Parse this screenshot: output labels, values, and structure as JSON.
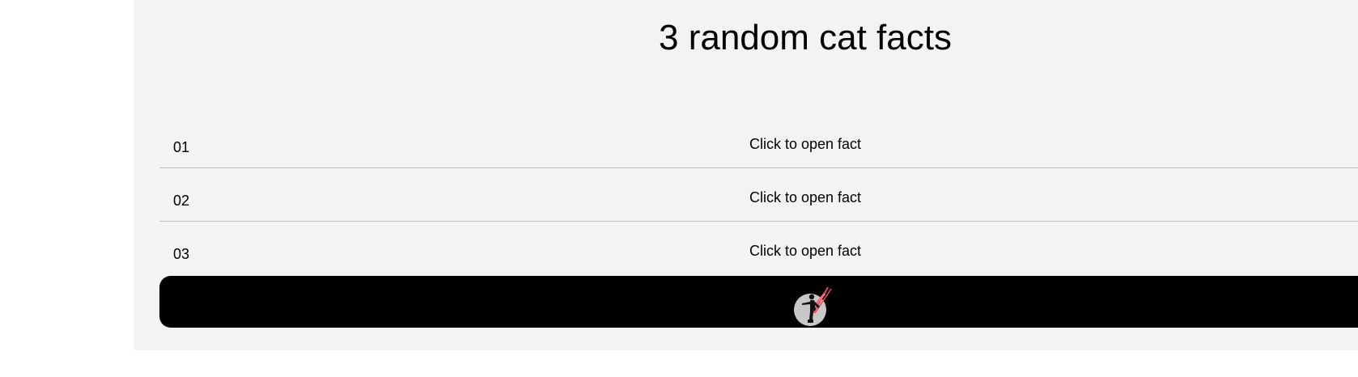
{
  "page": {
    "title": "3 random cat facts"
  },
  "facts": [
    {
      "number": "01",
      "label": "Click to open fact"
    },
    {
      "number": "02",
      "label": "Click to open fact"
    },
    {
      "number": "03",
      "label": "Click to open fact"
    }
  ],
  "colors": {
    "panel_background": "#f3f3f3",
    "divider": "#a9c6ea",
    "footer_background": "#000000"
  },
  "footer": {
    "logo_icon": "runner-logo-icon"
  }
}
